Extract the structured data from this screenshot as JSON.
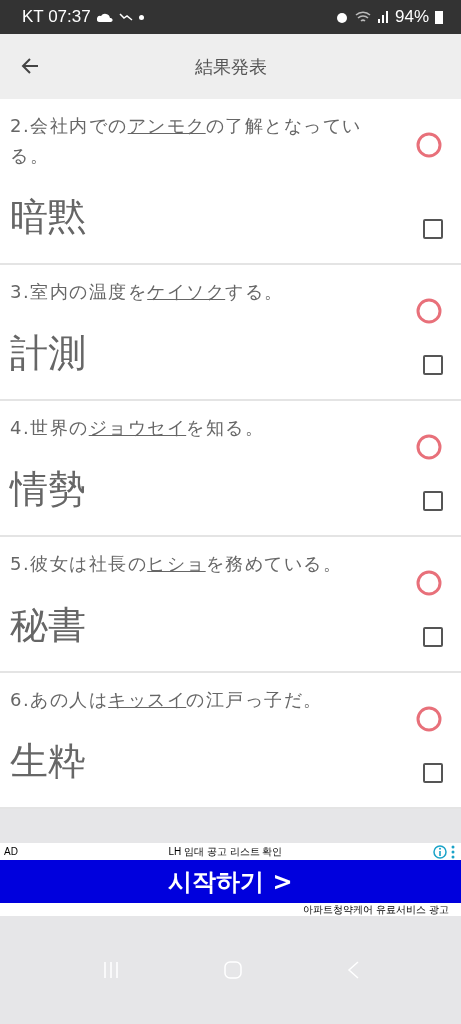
{
  "status_bar": {
    "carrier_time": "KT 07:37",
    "battery": "94%"
  },
  "header": {
    "title": "結果発表"
  },
  "questions": [
    {
      "prefix": "2.会社内での",
      "reading": "アンモク",
      "suffix": "の了解となっている。",
      "answer": "暗黙",
      "correct": true,
      "checked": false
    },
    {
      "prefix": "3.室内の温度を",
      "reading": "ケイソク",
      "suffix": "する。",
      "answer": "計測",
      "correct": true,
      "checked": false
    },
    {
      "prefix": "4.世界の",
      "reading": "ジョウセイ",
      "suffix": "を知る。",
      "answer": "情勢",
      "correct": true,
      "checked": false
    },
    {
      "prefix": "5.彼女は社長の",
      "reading": "ヒショ",
      "suffix": "を務めている。",
      "answer": "秘書",
      "correct": true,
      "checked": false
    },
    {
      "prefix": "6.あの人は",
      "reading": "キッスイ",
      "suffix": "の江戸っ子だ。",
      "answer": "生粋",
      "correct": true,
      "checked": false
    }
  ],
  "ad": {
    "label": "AD",
    "headline": "LH 임대 공고 리스트 확인",
    "button": "시작하기 >",
    "disclaimer": "아파트청약케어 유료서비스 광고"
  }
}
